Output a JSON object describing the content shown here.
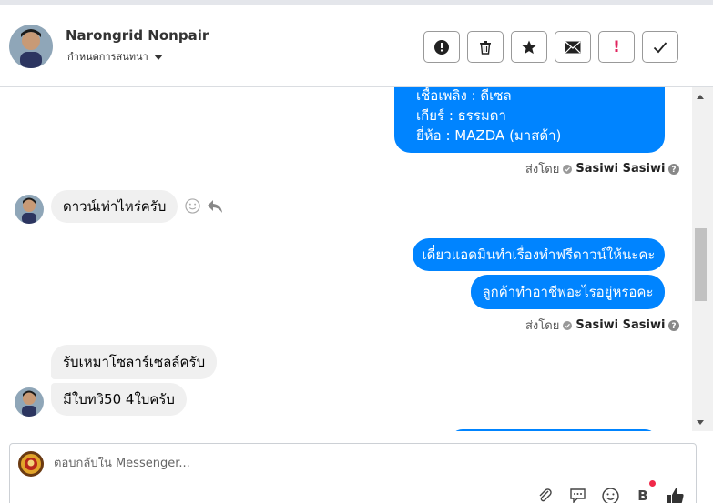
{
  "header": {
    "name": "Narongrid Nonpair",
    "subtitle": "กำหนดการสนทนา",
    "actions": [
      "spam",
      "delete",
      "star",
      "mark-unread",
      "important",
      "done"
    ],
    "important_label": "!"
  },
  "messages": {
    "car_info_lines": [
      "เชื้อเพลิง : ดีเซล",
      "เกียร์ : ธรรมดา",
      "ยี่ห้อ : MAZDA (มาสด้า)"
    ],
    "sent_by_prefix": "ส่งโดย",
    "sent_by_name": "Sasiwi Sasiwi",
    "in_down_payment": "ดาวน์เท่าไหร่ครับ",
    "out_reply_1": "เดี๋ยวแอดมินทำเรื่องทำฟรีดาวน์ให้นะคะ",
    "out_reply_2": "ลูกค้าทำอาชีพอะไรอยู่หรอคะ",
    "in_job": "รับเหมาโซลาร์เซลล์ครับ",
    "in_tawi": "มีใบทวิ50 4ใบครับ"
  },
  "composer": {
    "placeholder": "ตอบกลับใน Messenger..."
  },
  "colors": {
    "outgoing": "#0084ff",
    "incoming": "#f0f0f0",
    "badge": "#f02849"
  }
}
